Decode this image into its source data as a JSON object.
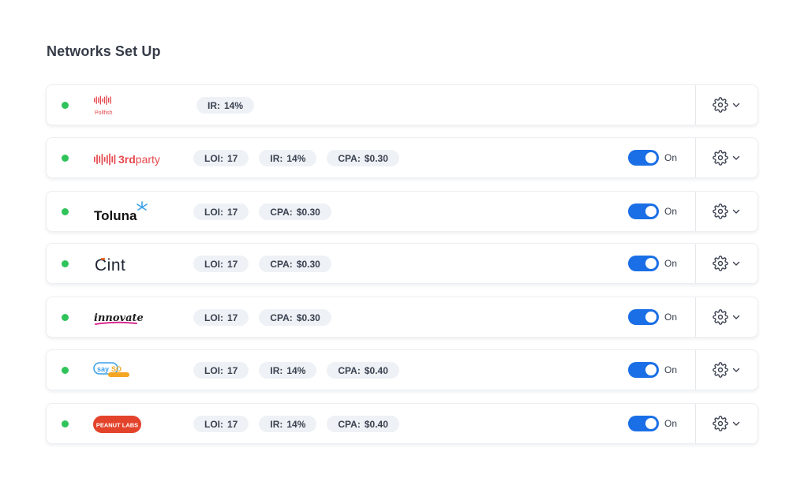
{
  "page": {
    "title": "Networks Set Up"
  },
  "colors": {
    "status_active": "#2fc35a",
    "toggle_on": "#1a6fe6",
    "pill_bg": "#eef1f5"
  },
  "networks": [
    {
      "name": "Pollfish",
      "logo": "pollfish-logo",
      "logo_text": "Pollfish",
      "status": "active",
      "pills": [
        {
          "key": "IR:",
          "value": "14%"
        }
      ],
      "toggle": null
    },
    {
      "name": "3rdparty",
      "logo": "3rdparty-logo",
      "logo_text": "3rdparty",
      "status": "active",
      "pills": [
        {
          "key": "LOI:",
          "value": "17"
        },
        {
          "key": "IR:",
          "value": "14%"
        },
        {
          "key": "CPA:",
          "value": "$0.30"
        }
      ],
      "toggle": {
        "state": "on",
        "label": "On"
      }
    },
    {
      "name": "Toluna",
      "logo": "toluna-logo",
      "logo_text": "Toluna",
      "status": "active",
      "pills": [
        {
          "key": "LOI:",
          "value": "17"
        },
        {
          "key": "CPA:",
          "value": "$0.30"
        }
      ],
      "toggle": {
        "state": "on",
        "label": "On"
      }
    },
    {
      "name": "Cint",
      "logo": "cint-logo",
      "logo_text": "Cint",
      "status": "active",
      "pills": [
        {
          "key": "LOI:",
          "value": "17"
        },
        {
          "key": "CPA:",
          "value": "$0.30"
        }
      ],
      "toggle": {
        "state": "on",
        "label": "On"
      }
    },
    {
      "name": "innovate",
      "logo": "innovate-logo",
      "logo_text": "innovate",
      "status": "active",
      "pills": [
        {
          "key": "LOI:",
          "value": "17"
        },
        {
          "key": "CPA:",
          "value": "$0.30"
        }
      ],
      "toggle": {
        "state": "on",
        "label": "On"
      }
    },
    {
      "name": "SaySo",
      "logo": "sayso-logo",
      "logo_text": "SaySo",
      "status": "active",
      "pills": [
        {
          "key": "LOI:",
          "value": "17"
        },
        {
          "key": "IR:",
          "value": "14%"
        },
        {
          "key": "CPA:",
          "value": "$0.40"
        }
      ],
      "toggle": {
        "state": "on",
        "label": "On"
      }
    },
    {
      "name": "Peanut Labs",
      "logo": "peanut-labs-logo",
      "logo_text": "PEANUT LABS",
      "status": "active",
      "pills": [
        {
          "key": "LOI:",
          "value": "17"
        },
        {
          "key": "IR:",
          "value": "14%"
        },
        {
          "key": "CPA:",
          "value": "$0.40"
        }
      ],
      "toggle": {
        "state": "on",
        "label": "On"
      }
    }
  ],
  "icons": {
    "settings": "gear-icon",
    "expand": "chevron-down-icon"
  }
}
